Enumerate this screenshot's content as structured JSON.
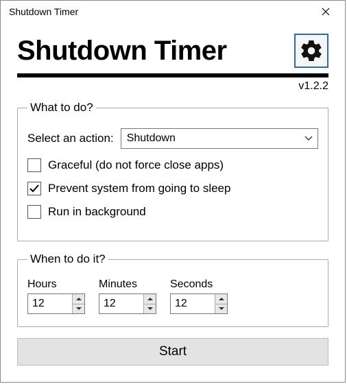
{
  "window": {
    "title": "Shutdown Timer"
  },
  "header": {
    "app_title": "Shutdown Timer",
    "version": "v1.2.2"
  },
  "section_action": {
    "legend": "What to do?",
    "select_label": "Select an action:",
    "selected": "Shutdown",
    "cb_graceful": {
      "label": "Graceful (do not force close apps)",
      "checked": false
    },
    "cb_prevent_sleep": {
      "label": "Prevent system from going to sleep",
      "checked": true
    },
    "cb_background": {
      "label": "Run in background",
      "checked": false
    }
  },
  "section_time": {
    "legend": "When to do it?",
    "hours_label": "Hours",
    "minutes_label": "Minutes",
    "seconds_label": "Seconds",
    "hours": "12",
    "minutes": "12",
    "seconds": "12"
  },
  "footer": {
    "start_label": "Start"
  }
}
